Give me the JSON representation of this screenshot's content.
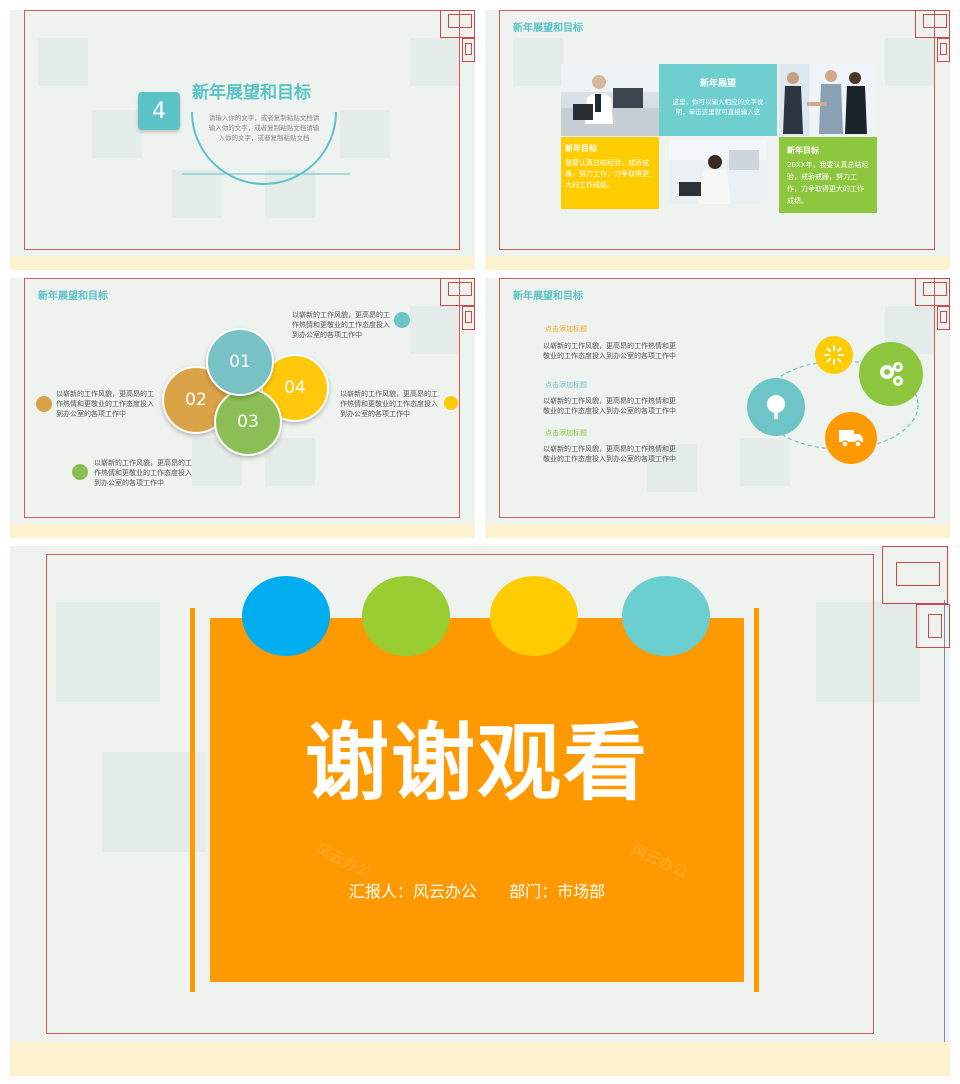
{
  "slide1": {
    "number": "4",
    "title": "新年展望和目标",
    "body": "请输入你的文字，或者复制粘贴文档请输入你的文字，或者复制粘贴文档请输入你的文字，或者复制粘贴文档"
  },
  "slide2": {
    "header": "新年展望和目标",
    "cell_vision_title": "新年展望",
    "cell_vision_text": "这里，你可以输入相应的文字说明，单击这里就可直接输入这",
    "cell_goal1_title": "新年目标",
    "cell_goal1_text": "我要认真总结经验，戒骄戒躁，努力工作，力争取得更大的工作成绩。",
    "cell_goal2_title": "新年目标",
    "cell_goal2_text": "20XX年，我要认真总结经验，戒骄戒躁，努力工作，力争取得更大的工作成绩。"
  },
  "slide3": {
    "header": "新年展望和目标",
    "bubbles": [
      "01",
      "02",
      "03",
      "04"
    ],
    "text_top": "以崭新的工作风貌，更高昂的工作热情和更敬业的工作态度投入到办公室的各项工作中",
    "text_left": "以崭新的工作风貌，更高昂的工作热情和更敬业的工作态度投入到办公室的各项工作中",
    "text_right": "以崭新的工作风貌，更高昂的工作热情和更敬业的工作态度投入到办公室的各项工作中",
    "text_bottom": "以崭新的工作风貌，更高昂的工作热情和更敬业的工作态度投入到办公室的各项工作中"
  },
  "slide4": {
    "header": "新年展望和目标",
    "items": [
      {
        "heading": "点击添加标题",
        "text": "以崭新的工作风貌，更高昂的工作热情和更敬业的工作态度投入到办公室的各项工作中"
      },
      {
        "heading": "点击添加标题",
        "text": "以崭新的工作风貌，更高昂的工作热情和更敬业的工作态度投入到办公室的各项工作中"
      },
      {
        "heading": "点击添加标题",
        "text": "以崭新的工作风貌，更高昂的工作热情和更敬业的工作态度投入到办公室的各项工作中"
      }
    ],
    "icons": [
      "sun-icon",
      "gears-icon",
      "tree-icon",
      "truck-icon"
    ]
  },
  "slide5": {
    "title": "谢谢观看",
    "reporter": "汇报人：风云办公",
    "department": "部门：市场部",
    "watermark": "风云办公"
  },
  "colors": {
    "teal": "#5bc3c6",
    "orange": "#ff9900",
    "yellow": "#ffcc00",
    "green": "#8dc63f",
    "blue": "#00aeef",
    "frame_red": "#d45a5a"
  }
}
